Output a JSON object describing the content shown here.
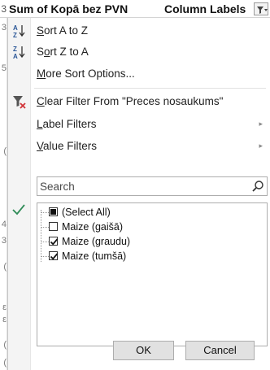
{
  "sheet": {
    "row_stub": "3",
    "pivot_title": "Sum of Kopā bez PVN",
    "column_labels": "Column Labels",
    "gutter_digits": [
      "3",
      "5",
      "(",
      "4",
      "3",
      "(",
      "ε",
      "ε",
      "(",
      "("
    ]
  },
  "menu": {
    "sort_az": {
      "pre": "",
      "u": "S",
      "post": "ort A to Z"
    },
    "sort_za": {
      "pre": "S",
      "u": "o",
      "post": "rt Z to A"
    },
    "more_sort": {
      "pre": "",
      "u": "M",
      "post": "ore Sort Options..."
    },
    "clear_filter": {
      "pre": "",
      "u": "C",
      "post": "lear Filter From \"Preces nosaukums\""
    },
    "label_filters": {
      "pre": "",
      "u": "L",
      "post": "abel Filters"
    },
    "value_filters": {
      "pre": "",
      "u": "V",
      "post": "alue Filters"
    },
    "submenu_arrow": "▸"
  },
  "search": {
    "placeholder": "Search"
  },
  "list": {
    "items": [
      {
        "label": "(Select All)",
        "state": "mixed"
      },
      {
        "label": "Maize (gaišā)",
        "state": "unchecked"
      },
      {
        "label": "Maize (graudu)",
        "state": "checked"
      },
      {
        "label": "Maize (tumšā)",
        "state": "checked"
      }
    ]
  },
  "buttons": {
    "ok": "OK",
    "cancel": "Cancel"
  },
  "icons": {
    "sort_az": "sort-ascending-icon",
    "sort_za": "sort-descending-icon",
    "clear_filter": "clear-filter-icon",
    "search": "search-icon",
    "check": "checkmark-icon",
    "dropdown": "filter-dropdown-icon"
  },
  "colors": {
    "accent_blue": "#2b5797",
    "clear_red": "#d13438",
    "check_green": "#2e8b57"
  }
}
